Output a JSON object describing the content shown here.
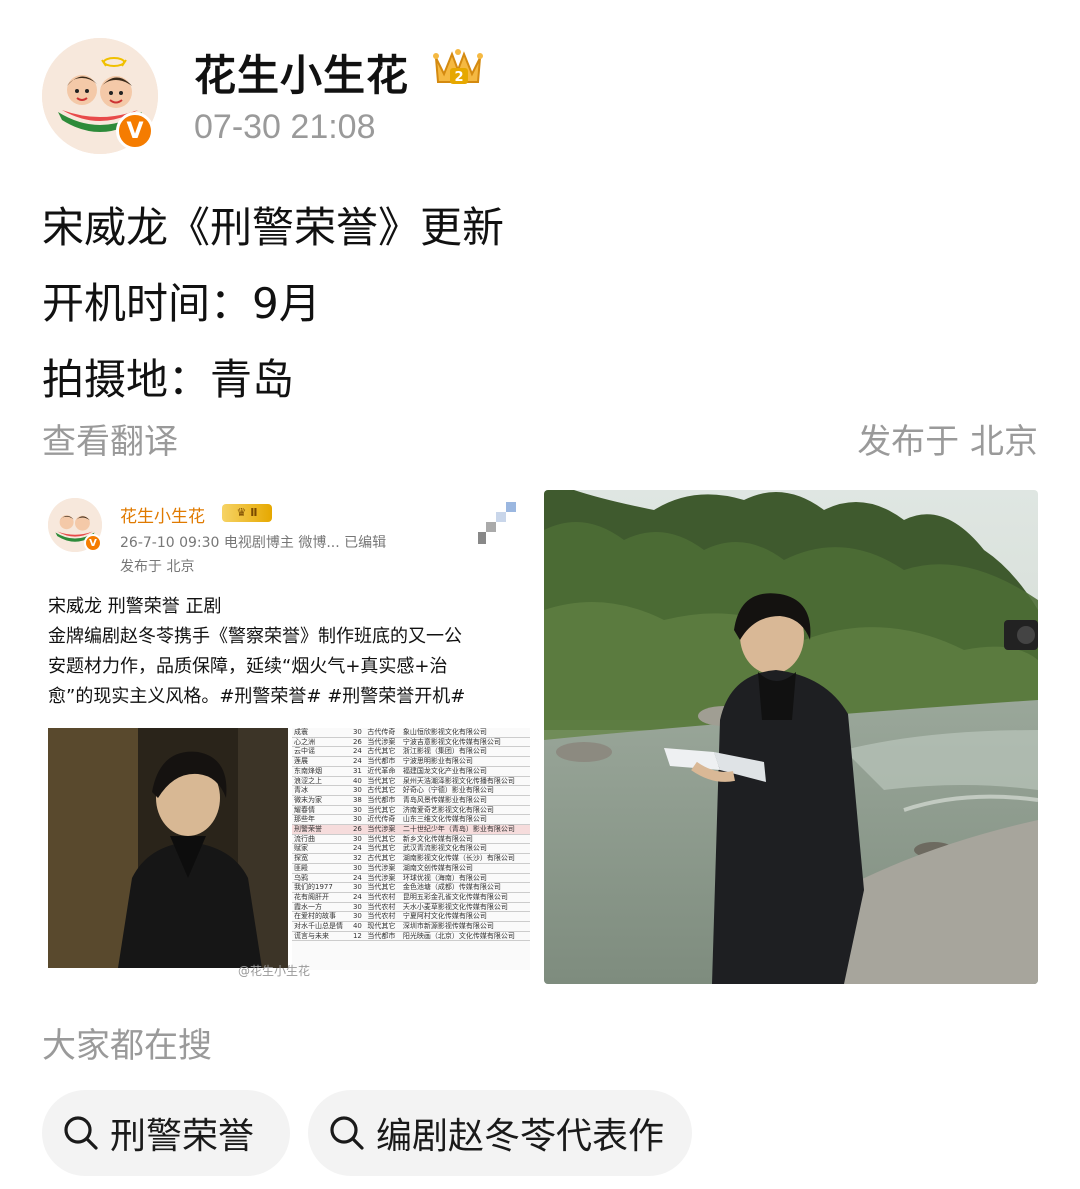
{
  "post": {
    "author": "花生小生花",
    "timestamp": "07-30 21:08",
    "lines": [
      "宋威龙《刑警荣誉》更新",
      "开机时间：9月",
      "拍摄地：青岛"
    ],
    "translate_label": "查看翻译",
    "location_label": "发布于 北京"
  },
  "embedded_post": {
    "author": "花生小生花",
    "meta": "26-7-10 09:30  电视剧博主 微博...  已编辑",
    "location": "发布于 北京",
    "text_lines": [
      "宋威龙 刑警荣誉 正剧",
      "金牌编剧赵冬苓携手《警察荣誉》制作班底的又一公",
      "安题材力作，品质保障，延续“烟火气+真实感+治",
      "愈”的现实主义风格。#刑警荣誉# #刑警荣誉开机#"
    ],
    "watermark": "@花生小生花",
    "table_rows": [
      [
        "成寰",
        "30",
        "古代传奇",
        "象山恒欣影视文化有限公司"
      ],
      [
        "心之洲",
        "26",
        "当代涉案",
        "宁波吉意影视文化传媒有限公司"
      ],
      [
        "云中谣",
        "24",
        "古代其它",
        "浙江影视（集团）有限公司"
      ],
      [
        "莲展",
        "24",
        "当代都市",
        "宁波思明影业有限公司"
      ],
      [
        "东南烽烟",
        "31",
        "近代革命",
        "福建国龙文化产业有限公司"
      ],
      [
        "浪涩之上",
        "40",
        "当代其它",
        "泉州天浩潮泽影视文化传播有限公司"
      ],
      [
        "青冰",
        "30",
        "古代其它",
        "好奇心（宁德）影业有限公司"
      ],
      [
        "微末为家",
        "38",
        "当代都市",
        "青岛风景传媒影业有限公司"
      ],
      [
        "耀春情",
        "30",
        "当代其它",
        "济南爱奇艺影视文化有限公司"
      ],
      [
        "那些年",
        "30",
        "近代传奇",
        "山东三维文化传媒有限公司"
      ],
      [
        "刑警荣誉",
        "26",
        "当代涉案",
        "二十世纪少年（青岛）影业有限公司"
      ],
      [
        "流行曲",
        "30",
        "当代其它",
        "新乡文化传媒有限公司"
      ],
      [
        "赋家",
        "24",
        "当代其它",
        "武汉青流影视文化有限公司"
      ],
      [
        "探宽",
        "32",
        "古代其它",
        "湖南影视文化传媒（长沙）有限公司"
      ],
      [
        "匪殿",
        "30",
        "当代涉案",
        "湖南文创传媒有限公司"
      ],
      [
        "乌鸦",
        "24",
        "当代涉案",
        "环球优视（海南）有限公司"
      ],
      [
        "我们的1977",
        "30",
        "当代其它",
        "金色池塘（成都）传媒有限公司"
      ],
      [
        "花有阁肝开",
        "24",
        "当代农村",
        "昆明五彩金孔雀文化传媒有限公司"
      ],
      [
        "霞水一方",
        "30",
        "当代农村",
        "天水小麦草影视文化传媒有限公司"
      ],
      [
        "在爱村的故事",
        "30",
        "当代农村",
        "宁夏阿村文化传媒有限公司"
      ],
      [
        "对水千山总是情",
        "40",
        "现代其它",
        "深圳市新源影视传媒有限公司"
      ],
      [
        "谎言与未来",
        "12",
        "当代都市",
        "阳光映画（北京）文化传媒有限公司"
      ]
    ]
  },
  "search_section": {
    "title": "大家都在搜",
    "chips": [
      "刑警荣誉",
      "编剧赵冬苓代表作"
    ]
  },
  "colors": {
    "accent_orange": "#f57c00",
    "muted_text": "#9a9a9a",
    "chip_bg": "#f3f3f3"
  }
}
